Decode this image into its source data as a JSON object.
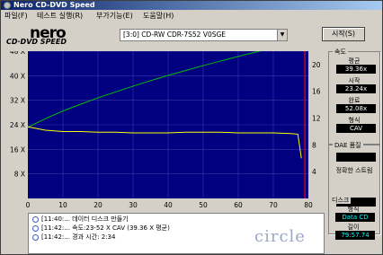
{
  "window": {
    "title": "Nero CD-DVD Speed"
  },
  "menu": [
    "파일(F)",
    "테스트 실행(R)",
    "부가기능(E)",
    "도움말(H)"
  ],
  "logo": {
    "main": "nero",
    "sub": "CD·DVD SPEED"
  },
  "drive": {
    "selected": "[3:0]   CD-RW CDR-7S52 V0SGE"
  },
  "start_button": "시작(S)",
  "speed": {
    "title": "속도",
    "average_label": "평균",
    "average_value": "39.36x",
    "start_label": "시작",
    "start_value": "23.24x",
    "end_label": "완료",
    "end_value": "52.08x",
    "type_label": "형식",
    "type_value": "CAV"
  },
  "dae": {
    "title": "DAE 품질",
    "accuracy_label": "정확한 스트림"
  },
  "disc": {
    "title": "디스크",
    "type_label": "형식",
    "type_value": "Data CD",
    "length_label": "길이",
    "length_value": "79:57.74"
  },
  "log": [
    "[11:40:...   데이터 디스크 만들기",
    "[11:42:...   속도:23-52 X CAV (39.36 X 평균)",
    "[11:42:...   경과 시간: 2:34"
  ],
  "watermark": "circle",
  "colors": {
    "plot_bg": "#000080",
    "transfer_line": "#00c000",
    "rpm_line": "#ffff00",
    "marker": "#ff0000"
  },
  "chart_data": {
    "type": "line",
    "x_ticks": [
      0,
      10,
      20,
      30,
      40,
      50,
      60,
      70,
      80
    ],
    "y_left_ticks": [
      "8 X",
      "16 X",
      "24 X",
      "32 X",
      "40 X",
      "48 X"
    ],
    "y_right_ticks": [
      "4",
      "8",
      "12",
      "16",
      "20"
    ],
    "xlim": [
      0,
      80
    ],
    "ylim_left": [
      0,
      48
    ],
    "ylim_right": [
      0,
      22
    ],
    "grid": true,
    "series": [
      {
        "x": [
          0,
          5,
          10,
          15,
          20,
          25,
          30,
          35,
          40,
          45,
          50,
          55,
          60,
          65,
          70,
          75
        ],
        "y": [
          23.2,
          26.0,
          28.5,
          30.7,
          32.8,
          34.7,
          36.6,
          38.4,
          40.1,
          41.7,
          43.3,
          44.8,
          46.3,
          47.7,
          49.1,
          50.4
        ]
      },
      {
        "x": [
          0,
          5,
          10,
          15,
          20,
          25,
          30,
          35,
          40,
          45,
          50,
          55,
          60,
          65,
          70,
          75,
          77,
          78
        ],
        "y": [
          10.7,
          10.2,
          10.0,
          10.0,
          9.9,
          9.9,
          9.8,
          9.8,
          9.8,
          9.9,
          9.9,
          9.9,
          9.8,
          9.8,
          9.8,
          9.7,
          9.6,
          6.0
        ]
      }
    ],
    "marker_x": 79
  }
}
